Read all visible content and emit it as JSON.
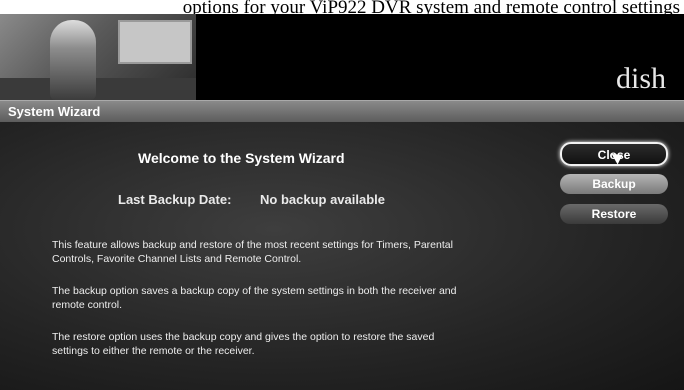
{
  "caption": "options for your ViP922 DVR system and remote control settings",
  "header": {
    "logo_text": "dish"
  },
  "window": {
    "title": "System Wizard"
  },
  "main": {
    "welcome": "Welcome to the System Wizard",
    "backup_label": "Last Backup Date:",
    "backup_value": "No backup available",
    "paragraphs": [
      "This feature allows backup and restore of the most recent settings for Timers, Parental Controls, Favorite Channel Lists and Remote Control.",
      "The backup option saves a backup copy of the system settings in both the receiver and remote control.",
      "The restore option uses the backup copy and gives the option to restore the saved settings to either the remote or the receiver."
    ]
  },
  "buttons": {
    "close": "Close",
    "backup": "Backup",
    "restore": "Restore"
  }
}
